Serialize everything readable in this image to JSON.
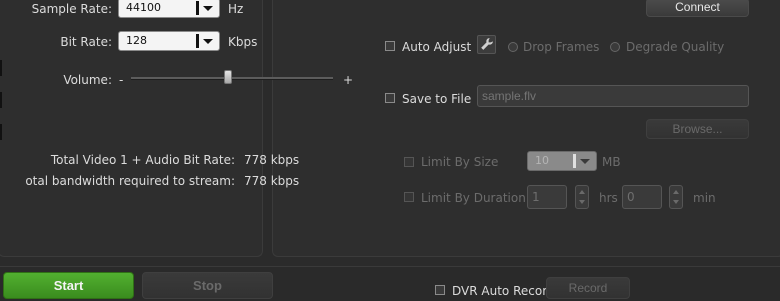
{
  "audio": {
    "sample_rate_label": "Sample Rate:",
    "sample_rate_value": "44100",
    "sample_rate_unit": "Hz",
    "bit_rate_label": "Bit Rate:",
    "bit_rate_value": "128",
    "bit_rate_unit": "Kbps",
    "volume_label": "Volume:",
    "volume_minus": "-",
    "volume_plus": "+",
    "volume_level": 0.48
  },
  "stats": {
    "total_bitrate_label": "Total Video 1 + Audio Bit Rate:",
    "total_bitrate_value": "778 kbps",
    "bandwidth_label": "otal bandwidth required to stream:",
    "bandwidth_value": "778 kbps"
  },
  "output": {
    "connect_label": "Connect",
    "auto_adjust_label": "Auto Adjust",
    "drop_frames_label": "Drop Frames",
    "degrade_quality_label": "Degrade Quality",
    "save_to_file_label": "Save to File",
    "file_placeholder": "sample.flv",
    "browse_label": "Browse...",
    "limit_size_label": "Limit By Size",
    "limit_size_value": "10",
    "limit_size_unit": "MB",
    "limit_duration_label": "Limit By Duration",
    "hours_value": "1",
    "hours_unit": "hrs",
    "minutes_value": "0",
    "minutes_unit": "min"
  },
  "bottom": {
    "start_label": "Start",
    "stop_label": "Stop",
    "dvr_label": "DVR Auto Record",
    "record_label": "Record"
  },
  "colors": {
    "start_green": "#3f9a22",
    "bg": "#2b2b2b"
  }
}
